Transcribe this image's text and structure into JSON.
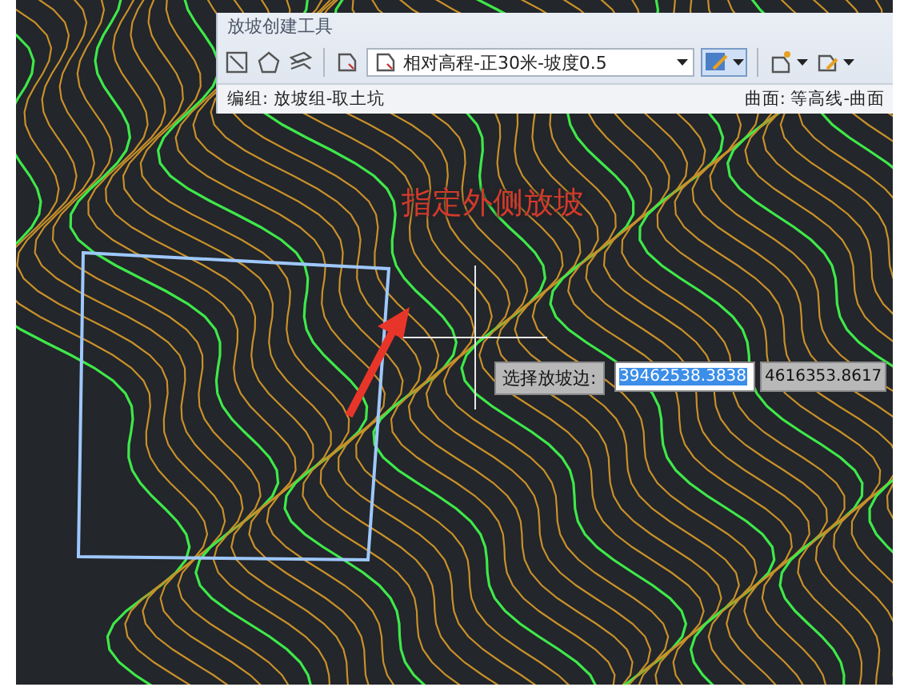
{
  "toolbar": {
    "title": "放坡创建工具",
    "dropdown": {
      "value": "相对高程-正30米-坡度0.5"
    },
    "status_left": "编组: 放坡组-取土坑",
    "status_right": "曲面: 等高线-曲面"
  },
  "annotation": "指定外侧放坡",
  "prompt": {
    "label": "选择放坡边:",
    "x_value": "39462538.3838",
    "y_value": "4616353.8617"
  }
}
